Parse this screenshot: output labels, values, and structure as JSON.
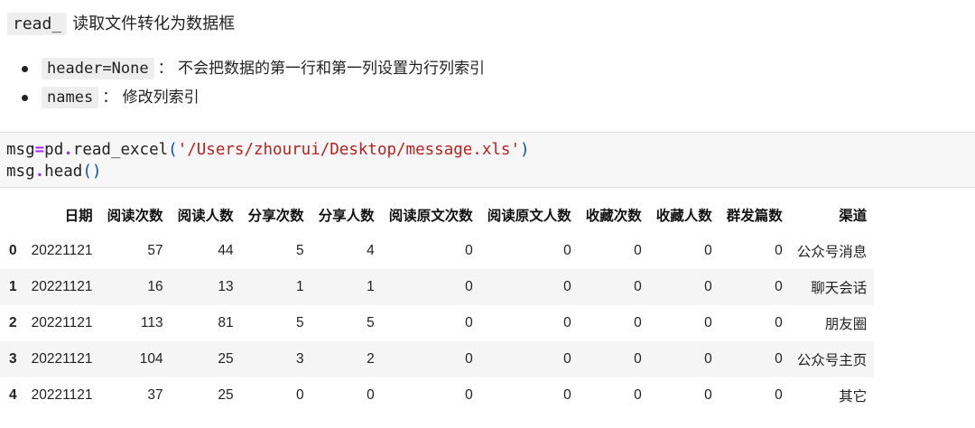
{
  "markdown": {
    "heading": {
      "code": "read_",
      "text": "读取文件转化为数据框"
    },
    "bullets": [
      {
        "code": "header=None",
        "text": "： 不会把数据的第一行和第一列设置为行列索引"
      },
      {
        "code": "names",
        "text": "： 修改列索引"
      }
    ]
  },
  "code_cell": {
    "line1": {
      "var": "msg",
      "eq": "=",
      "mod": "pd",
      "dot": ".",
      "func": "read_excel",
      "open": "(",
      "str": "'/Users/zhourui/Desktop/message.xls'",
      "close": ")"
    },
    "line2": {
      "var": "msg",
      "dot": ".",
      "func": "head",
      "parens": "()"
    }
  },
  "dataframe": {
    "columns": [
      "日期",
      "阅读次数",
      "阅读人数",
      "分享次数",
      "分享人数",
      "阅读原文次数",
      "阅读原文人数",
      "收藏次数",
      "收藏人数",
      "群发篇数",
      "渠道"
    ],
    "rows": [
      {
        "index": "0",
        "cells": [
          "20221121",
          "57",
          "44",
          "5",
          "4",
          "0",
          "0",
          "0",
          "0",
          "0",
          "公众号消息"
        ]
      },
      {
        "index": "1",
        "cells": [
          "20221121",
          "16",
          "13",
          "1",
          "1",
          "0",
          "0",
          "0",
          "0",
          "0",
          "聊天会话"
        ]
      },
      {
        "index": "2",
        "cells": [
          "20221121",
          "113",
          "81",
          "5",
          "5",
          "0",
          "0",
          "0",
          "0",
          "0",
          "朋友圈"
        ]
      },
      {
        "index": "3",
        "cells": [
          "20221121",
          "104",
          "25",
          "3",
          "2",
          "0",
          "0",
          "0",
          "0",
          "0",
          "公众号主页"
        ]
      },
      {
        "index": "4",
        "cells": [
          "20221121",
          "37",
          "25",
          "0",
          "0",
          "0",
          "0",
          "0",
          "0",
          "0",
          "其它"
        ]
      }
    ]
  },
  "colors": {
    "code_background": "#f7f7f7",
    "operator": "#aa22ff",
    "punctuation": "#0055aa",
    "string": "#ba2121",
    "striped_row": "#f5f5f5"
  }
}
